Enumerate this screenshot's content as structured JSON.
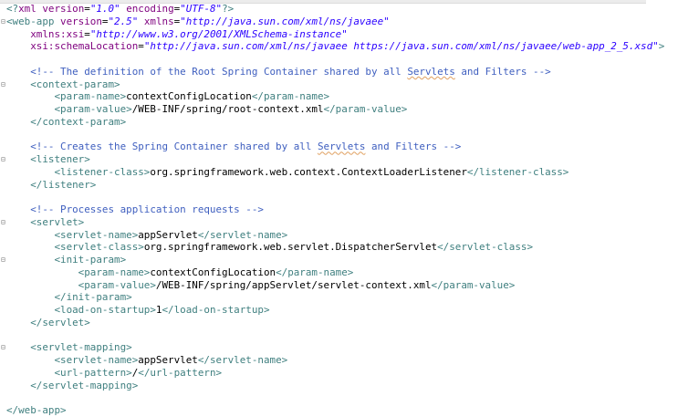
{
  "editor": {
    "lines": [
      {
        "fold": false,
        "tokens": [
          [
            "t",
            "<?"
          ],
          [
            "a",
            "xml "
          ],
          [
            "a",
            "version"
          ],
          [
            "x",
            "="
          ],
          [
            "v",
            "\"1.0\""
          ],
          [
            "x",
            " "
          ],
          [
            "a",
            "encoding"
          ],
          [
            "x",
            "="
          ],
          [
            "v",
            "\"UTF-8\""
          ],
          [
            "t",
            "?>"
          ]
        ]
      },
      {
        "fold": true,
        "tokens": [
          [
            "t",
            "<web-app "
          ],
          [
            "a",
            "version"
          ],
          [
            "x",
            "="
          ],
          [
            "v",
            "\"2.5\""
          ],
          [
            "x",
            " "
          ],
          [
            "a",
            "xmlns"
          ],
          [
            "x",
            "="
          ],
          [
            "v",
            "\"http://java.sun.com/xml/ns/javaee\""
          ]
        ]
      },
      {
        "fold": false,
        "tokens": [
          [
            "x",
            "    "
          ],
          [
            "a",
            "xmlns:xsi"
          ],
          [
            "x",
            "="
          ],
          [
            "v",
            "\"http://www.w3.org/2001/XMLSchema-instance\""
          ]
        ]
      },
      {
        "fold": false,
        "tokens": [
          [
            "x",
            "    "
          ],
          [
            "a",
            "xsi:schemaLocation"
          ],
          [
            "x",
            "="
          ],
          [
            "v",
            "\"http://java.sun.com/xml/ns/javaee https://java.sun.com/xml/ns/javaee/web-app_2_5.xsd\""
          ],
          [
            "t",
            ">"
          ]
        ]
      },
      {
        "fold": false,
        "tokens": []
      },
      {
        "fold": false,
        "tokens": [
          [
            "c",
            "    <!-- The definition of the Root Spring Container shared by all "
          ],
          [
            "cs",
            "Servlets"
          ],
          [
            "c",
            " and Filters -->"
          ]
        ]
      },
      {
        "fold": true,
        "tokens": [
          [
            "t",
            "    <context-param>"
          ]
        ]
      },
      {
        "fold": false,
        "tokens": [
          [
            "t",
            "        <param-name>"
          ],
          [
            "x",
            "contextConfigLocation"
          ],
          [
            "t",
            "</param-name>"
          ]
        ]
      },
      {
        "fold": false,
        "tokens": [
          [
            "t",
            "        <param-value>"
          ],
          [
            "x",
            "/WEB-INF/spring/root-context.xml"
          ],
          [
            "t",
            "</param-value>"
          ]
        ]
      },
      {
        "fold": false,
        "tokens": [
          [
            "t",
            "    </context-param>"
          ]
        ]
      },
      {
        "fold": false,
        "tokens": []
      },
      {
        "fold": false,
        "tokens": [
          [
            "c",
            "    <!-- Creates the Spring Container shared by all "
          ],
          [
            "cs",
            "Servlets"
          ],
          [
            "c",
            " and Filters -->"
          ]
        ]
      },
      {
        "fold": true,
        "tokens": [
          [
            "t",
            "    <listener>"
          ]
        ]
      },
      {
        "fold": false,
        "tokens": [
          [
            "t",
            "        <listener-class>"
          ],
          [
            "x",
            "org.springframework.web.context.ContextLoaderListener"
          ],
          [
            "t",
            "</listener-class>"
          ]
        ]
      },
      {
        "fold": false,
        "tokens": [
          [
            "t",
            "    </listener>"
          ]
        ]
      },
      {
        "fold": false,
        "tokens": []
      },
      {
        "fold": false,
        "tokens": [
          [
            "c",
            "    <!-- Processes application requests -->"
          ]
        ]
      },
      {
        "fold": true,
        "tokens": [
          [
            "t",
            "    <servlet>"
          ]
        ]
      },
      {
        "fold": false,
        "tokens": [
          [
            "t",
            "        <servlet-name>"
          ],
          [
            "x",
            "appServlet"
          ],
          [
            "t",
            "</servlet-name>"
          ]
        ]
      },
      {
        "fold": false,
        "tokens": [
          [
            "t",
            "        <servlet-class>"
          ],
          [
            "x",
            "org.springframework.web.servlet.DispatcherServlet"
          ],
          [
            "t",
            "</servlet-class>"
          ]
        ]
      },
      {
        "fold": true,
        "tokens": [
          [
            "t",
            "        <init-param>"
          ]
        ]
      },
      {
        "fold": false,
        "tokens": [
          [
            "t",
            "            <param-name>"
          ],
          [
            "x",
            "contextConfigLocation"
          ],
          [
            "t",
            "</param-name>"
          ]
        ]
      },
      {
        "fold": false,
        "tokens": [
          [
            "t",
            "            <param-value>"
          ],
          [
            "x",
            "/WEB-INF/spring/appServlet/servlet-context.xml"
          ],
          [
            "t",
            "</param-value>"
          ]
        ]
      },
      {
        "fold": false,
        "tokens": [
          [
            "t",
            "        </init-param>"
          ]
        ]
      },
      {
        "fold": false,
        "tokens": [
          [
            "t",
            "        <load-on-startup>"
          ],
          [
            "x",
            "1"
          ],
          [
            "t",
            "</load-on-startup>"
          ]
        ]
      },
      {
        "fold": false,
        "tokens": [
          [
            "t",
            "    </servlet>"
          ]
        ]
      },
      {
        "fold": false,
        "tokens": []
      },
      {
        "fold": true,
        "tokens": [
          [
            "t",
            "    <servlet-mapping>"
          ]
        ]
      },
      {
        "fold": false,
        "tokens": [
          [
            "t",
            "        <servlet-name>"
          ],
          [
            "x",
            "appServlet"
          ],
          [
            "t",
            "</servlet-name>"
          ]
        ]
      },
      {
        "fold": false,
        "tokens": [
          [
            "t",
            "        <url-pattern>"
          ],
          [
            "x",
            "/"
          ],
          [
            "t",
            "</url-pattern>"
          ]
        ]
      },
      {
        "fold": false,
        "tokens": [
          [
            "t",
            "    </servlet-mapping>"
          ]
        ]
      },
      {
        "fold": false,
        "tokens": []
      },
      {
        "fold": false,
        "tokens": [
          [
            "t",
            "</web-app>"
          ]
        ]
      }
    ]
  }
}
